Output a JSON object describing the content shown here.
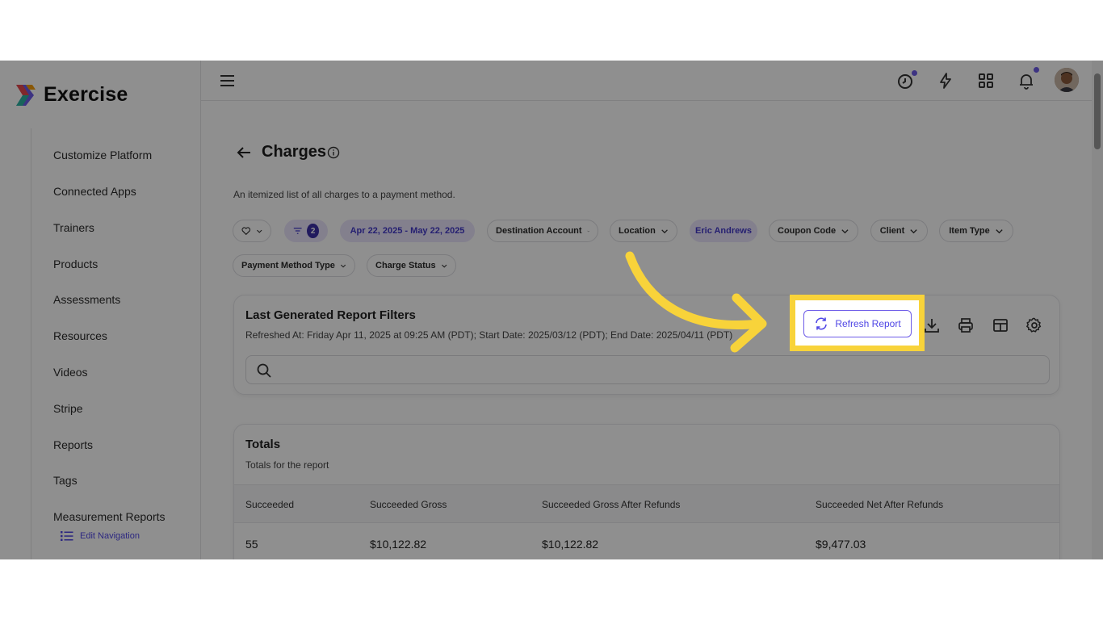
{
  "app": {
    "brand": "Exercise"
  },
  "sidebar": {
    "items": [
      {
        "label": "Customize Platform"
      },
      {
        "label": "Connected Apps"
      },
      {
        "label": "Trainers"
      },
      {
        "label": "Products"
      },
      {
        "label": "Assessments"
      },
      {
        "label": "Resources"
      },
      {
        "label": "Videos"
      },
      {
        "label": "Stripe"
      },
      {
        "label": "Reports"
      },
      {
        "label": "Tags"
      },
      {
        "label": "Measurement Reports"
      }
    ],
    "edit_nav_label": "Edit Navigation"
  },
  "topbar": {
    "icons": [
      "menu-icon",
      "clock-icon",
      "lightning-icon",
      "apps-grid-icon",
      "bell-icon",
      "avatar"
    ]
  },
  "page": {
    "title": "Charges",
    "subtitle": "An itemized list of all charges to a payment method."
  },
  "filters": {
    "filter_count": "2",
    "date_range": "Apr 22, 2025 - May 22, 2025",
    "chips": {
      "destination": "Destination Account",
      "location": "Location",
      "trainer": "Eric Andrews",
      "coupon": "Coupon Code",
      "client": "Client",
      "item_type": "Item Type",
      "payment_method": "Payment Method Type",
      "charge_status": "Charge Status"
    }
  },
  "report_filters": {
    "title": "Last Generated Report Filters",
    "meta": "Refreshed At: Friday Apr 11, 2025 at 09:25 AM (PDT); Start Date: 2025/03/12 (PDT); End Date: 2025/04/11 (PDT)",
    "refresh_label": "Refresh Report",
    "search_placeholder": ""
  },
  "totals": {
    "title": "Totals",
    "subtitle": "Totals for the report",
    "headers": [
      "Succeeded",
      "Succeeded Gross",
      "Succeeded Gross After Refunds",
      "Succeeded Net After Refunds"
    ],
    "values": [
      "55",
      "$10,122.82",
      "$10,122.82",
      "$9,477.03"
    ]
  },
  "colors": {
    "accent": "#4f46e5",
    "highlight": "#f8d33a",
    "chip_active": "#e9e5fb"
  }
}
